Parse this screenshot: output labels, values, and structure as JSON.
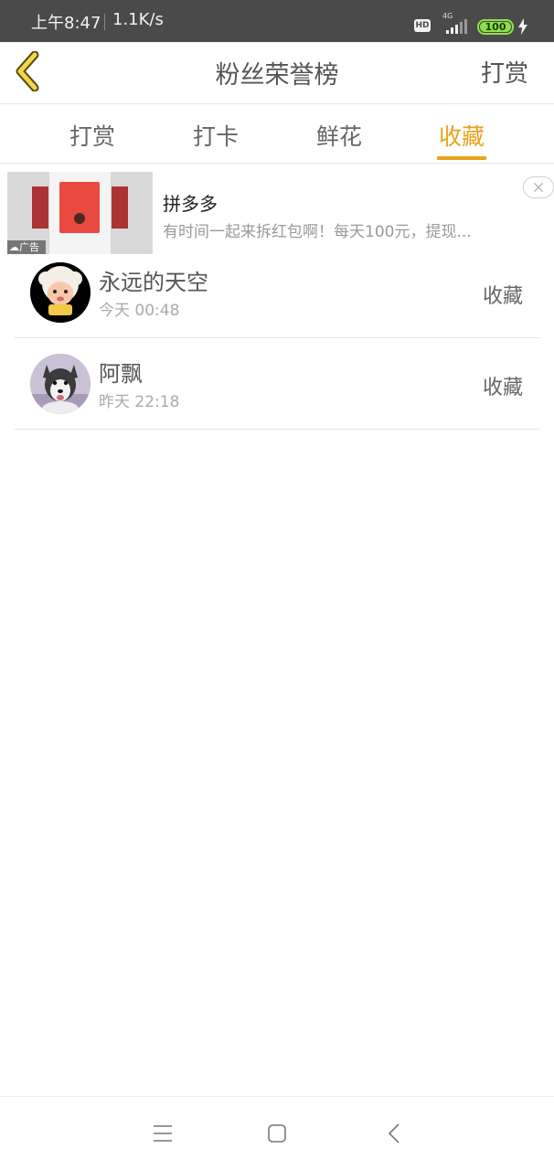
{
  "status_bar": {
    "time": "上午8:47",
    "network_speed": "1.1K/s",
    "hd_label": "HD",
    "network_type": "4G",
    "battery": "100"
  },
  "header": {
    "title": "粉丝荣誉榜",
    "right_action": "打赏"
  },
  "tabs": [
    {
      "label": "打赏",
      "active": false
    },
    {
      "label": "打卡",
      "active": false
    },
    {
      "label": "鲜花",
      "active": false
    },
    {
      "label": "收藏",
      "active": true
    }
  ],
  "ad": {
    "title": "拼多多",
    "description": "有时间一起来拆红包啊！每天100元，提现...",
    "badge": "广告"
  },
  "list": [
    {
      "name": "永远的天空",
      "time": "今天 00:48",
      "action": "收藏",
      "avatar": "sheep-cartoon-avatar"
    },
    {
      "name": "阿飘",
      "time": "昨天 22:18",
      "action": "收藏",
      "avatar": "husky-dog-avatar"
    }
  ],
  "colors": {
    "accent": "#e8a319",
    "status_bar": "#4a4a4a",
    "battery": "#8ee04b"
  }
}
